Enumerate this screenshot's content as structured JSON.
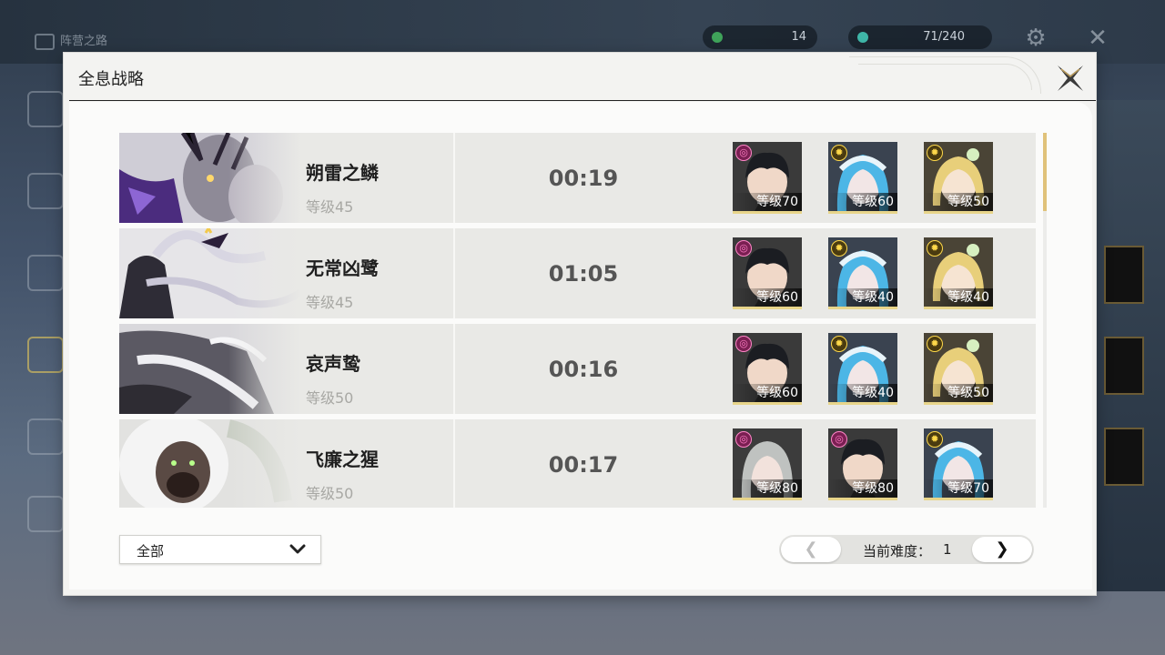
{
  "background": {
    "breadcrumb": "阵营之路",
    "resource_1": "14",
    "resource_2": "71/240"
  },
  "modal": {
    "title": "全息战略",
    "close_icon": "close-x-icon"
  },
  "rows": [
    {
      "boss_name": "朔雷之鳞",
      "boss_level": "等级45",
      "time": "00:19",
      "team": [
        {
          "element": "pink",
          "level": "等级70",
          "portrait": "dark-hair-male"
        },
        {
          "element": "sun",
          "level": "等级60",
          "portrait": "blue-hair-girl"
        },
        {
          "element": "sun",
          "level": "等级50",
          "portrait": "blonde-hair-girl"
        }
      ]
    },
    {
      "boss_name": "无常凶鹭",
      "boss_level": "等级45",
      "time": "01:05",
      "team": [
        {
          "element": "pink",
          "level": "等级60",
          "portrait": "dark-hair-male"
        },
        {
          "element": "sun",
          "level": "等级40",
          "portrait": "blue-hair-girl"
        },
        {
          "element": "sun",
          "level": "等级40",
          "portrait": "blonde-hair-girl"
        }
      ]
    },
    {
      "boss_name": "哀声鸷",
      "boss_level": "等级50",
      "time": "00:16",
      "team": [
        {
          "element": "pink",
          "level": "等级60",
          "portrait": "dark-hair-male"
        },
        {
          "element": "sun",
          "level": "等级40",
          "portrait": "blue-hair-girl"
        },
        {
          "element": "sun",
          "level": "等级50",
          "portrait": "blonde-hair-girl"
        }
      ]
    },
    {
      "boss_name": "飞廉之猩",
      "boss_level": "等级50",
      "time": "00:17",
      "team": [
        {
          "element": "pink",
          "level": "等级80",
          "portrait": "grey-hair-female"
        },
        {
          "element": "pink",
          "level": "等级80",
          "portrait": "dark-hair-male"
        },
        {
          "element": "sun",
          "level": "等级70",
          "portrait": "blue-hair-girl"
        }
      ]
    }
  ],
  "filter": {
    "selected": "全部"
  },
  "difficulty": {
    "label": "当前难度：",
    "value": "1",
    "prev": "❮",
    "next": "❯"
  },
  "colors": {
    "accent_gold": "#e0c27a",
    "row_bg": "#e9e9e6",
    "panel_bg": "#fbfbfa",
    "element_pink": "#ff7ec5",
    "element_sun": "#ffd94a"
  }
}
